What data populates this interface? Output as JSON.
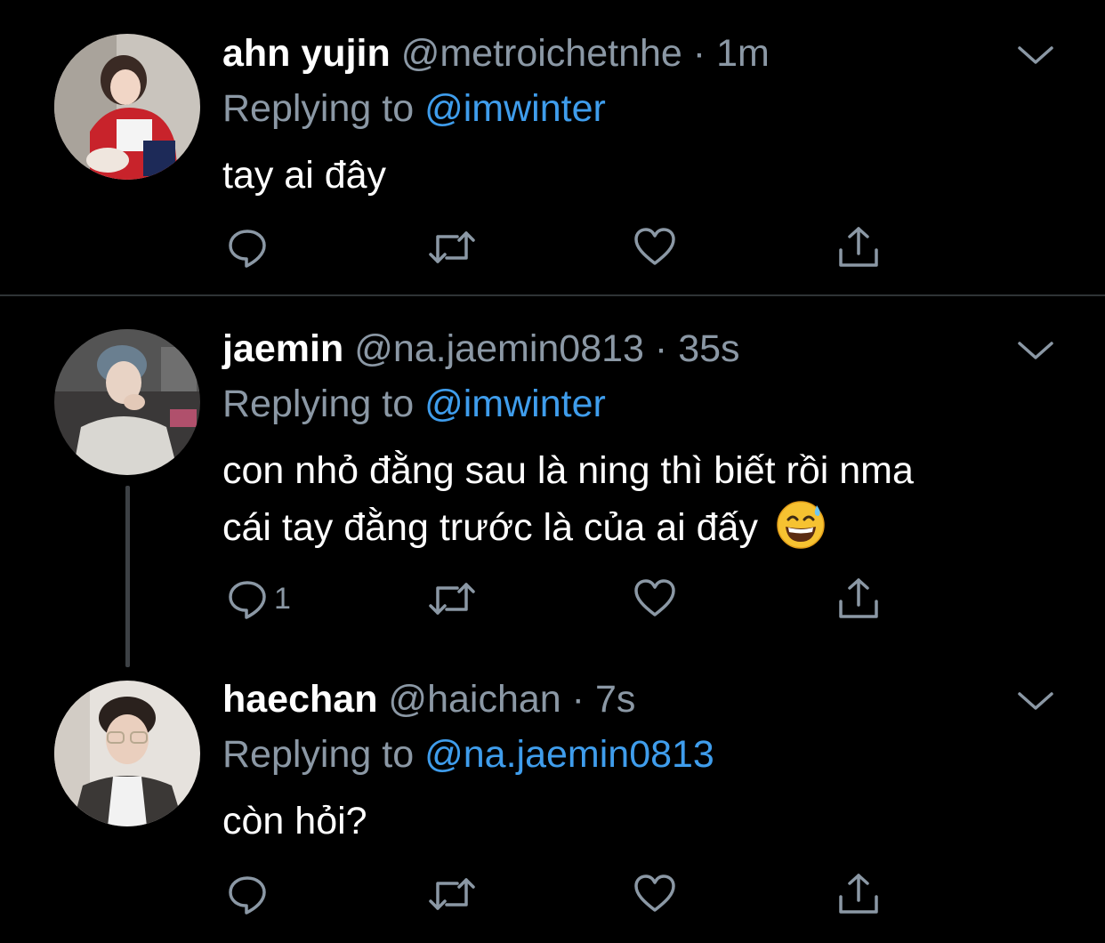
{
  "colors": {
    "background": "#000000",
    "text": "#ffffff",
    "secondary": "#8b98a5",
    "mention": "#3f9dec",
    "divider": "#2f3336"
  },
  "tweets": [
    {
      "name": "ahn yujin",
      "handle": "@metroichetnhe",
      "separator": "·",
      "time": "1m",
      "reply_label": "Replying to",
      "reply_mention": "@imwinter",
      "text_lines": [
        "tay ai đây"
      ],
      "reply_count": "",
      "icons": [
        "reply-icon",
        "retweet-icon",
        "like-icon",
        "share-icon",
        "chevron-down-icon"
      ]
    },
    {
      "name": "jaemin",
      "handle": "@na.jaemin0813",
      "separator": "·",
      "time": "35s",
      "reply_label": "Replying to",
      "reply_mention": "@imwinter",
      "text_lines": [
        "con nhỏ đằng sau là ning thì biết rồi nma",
        "cái tay đằng trước là của ai đấy"
      ],
      "emoji": "grinning-sweat-emoji",
      "reply_count": "1",
      "icons": [
        "reply-icon",
        "retweet-icon",
        "like-icon",
        "share-icon",
        "chevron-down-icon"
      ]
    },
    {
      "name": "haechan",
      "handle": "@haichan",
      "separator": "·",
      "time": "7s",
      "reply_label": "Replying to",
      "reply_mention": "@na.jaemin0813",
      "text_lines": [
        "còn hỏi?"
      ],
      "reply_count": "",
      "icons": [
        "reply-icon",
        "retweet-icon",
        "like-icon",
        "share-icon",
        "chevron-down-icon"
      ]
    }
  ]
}
